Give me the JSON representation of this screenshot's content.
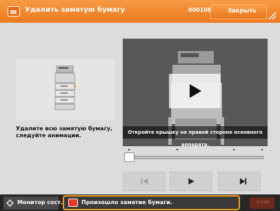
{
  "titlebar": {
    "title": "Удалить замятую бумагу",
    "code": "000108",
    "close_label": "Закрыть",
    "icon": "paper-jam-icon",
    "color": "#ec7a1f"
  },
  "left_panel": {
    "caption": "Удалите всю замятую бумагу, следуйте анимации."
  },
  "video": {
    "caption": "Откройте крышку на правой стороне основного аппарата."
  },
  "controls": {
    "prev_icon": "skip-previous-icon",
    "play_icon": "play-icon",
    "next_icon": "skip-next-icon"
  },
  "bottombar": {
    "monitor_label": "Монитор сост.",
    "error_text": "Произошло замятие бумаги.",
    "stop_label": "Стоп"
  }
}
